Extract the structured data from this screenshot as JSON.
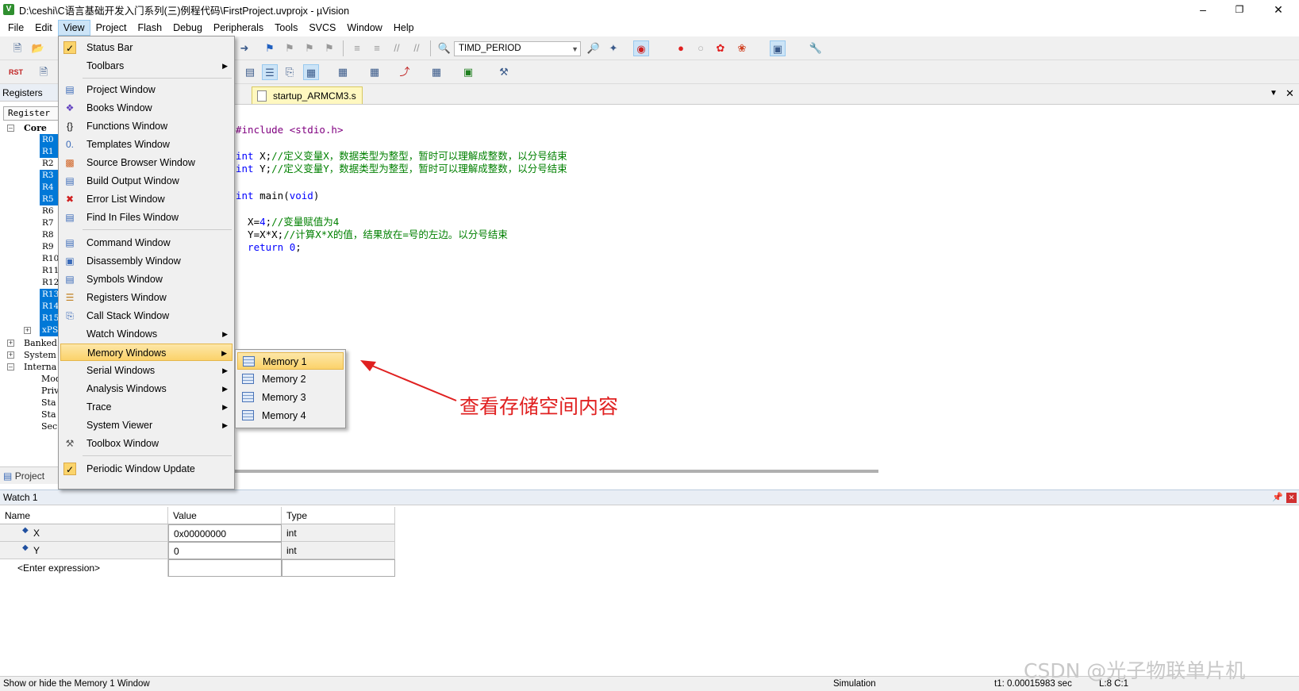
{
  "window": {
    "title": "D:\\ceshi\\C语言基础开发入门系列(三)例程代码\\FirstProject.uvprojx - µVision",
    "icon_letter": "V"
  },
  "menubar": [
    "File",
    "Edit",
    "View",
    "Project",
    "Flash",
    "Debug",
    "Peripherals",
    "Tools",
    "SVCS",
    "Window",
    "Help"
  ],
  "toolbar": {
    "target_combo": "TIMD_PERIOD"
  },
  "registers_panel": {
    "title": "Registers",
    "column": "Register",
    "core_label": "Core",
    "regs": [
      "R0",
      "R1",
      "R2",
      "R3",
      "R4",
      "R5",
      "R6",
      "R7",
      "R8",
      "R9",
      "R10",
      "R11",
      "R12",
      "R13",
      "R14",
      "R15",
      "xPS"
    ],
    "selected": [
      "R0",
      "R1",
      "R3",
      "R4",
      "R5",
      "R13",
      "R14",
      "R15",
      "xPS"
    ],
    "groups": [
      "Banked",
      "System",
      "Interna"
    ],
    "internal_children": [
      "Mode",
      "Priv",
      "Sta",
      "Sta",
      "Sec"
    ],
    "bottom_tab": "Project"
  },
  "editor": {
    "tab_label": "startup_ARMCM3.s",
    "lines": [
      {
        "pre": "#include ",
        "str": "<stdio.h>",
        "cm": ""
      },
      {
        "pre": "",
        "str": "",
        "cm": ""
      },
      {
        "kw": "int",
        " pre": "",
        "code": " X;",
        "cm": "//定义变量X，数据类型为整型，暂时可以理解成整数，以分号结束"
      },
      {
        "kw": "int",
        "code": " Y;",
        "cm": "//定义变量Y，数据类型为整型，暂时可以理解成整数，以分号结束"
      }
    ],
    "code": {
      "l1a": "#include ",
      "l1b": "<stdio.h>",
      "l3kw": "int",
      "l3code": " X;",
      "l3cm": "//定义变量X，数据类型为整型，暂时可以理解成整数，以分号结束",
      "l4kw": "int",
      "l4code": " Y;",
      "l4cm": "//定义变量Y，数据类型为整型，暂时可以理解成整数，以分号结束",
      "l6kw": "int",
      "l6code": " main(",
      "l6kw2": "void",
      "l6end": ")",
      "l8code": "  X=",
      "l8num": "4",
      "l8semi": ";",
      "l8cm": "//变量赋值为4",
      "l9code": "  Y=X*X;",
      "l9cm": "//计算X*X的值，结果放在=号的左边。以分号结束",
      "l10kw": "  return",
      "l10num": " 0",
      "l10semi": ";"
    }
  },
  "view_menu": {
    "items": [
      {
        "label": "Status Bar",
        "checked": true,
        "icon": "check"
      },
      {
        "label": "Toolbars",
        "submenu": true
      },
      {
        "label": "Project Window",
        "icon": "project-window-icon"
      },
      {
        "label": "Books Window",
        "icon": "books-icon"
      },
      {
        "label": "Functions Window",
        "icon": "braces-icon"
      },
      {
        "label": "Templates Window",
        "icon": "templates-icon"
      },
      {
        "label": "Source Browser Window",
        "icon": "source-browser-icon"
      },
      {
        "label": "Build Output Window",
        "icon": "build-output-icon"
      },
      {
        "label": "Error List Window",
        "icon": "error-icon"
      },
      {
        "label": "Find In Files Window",
        "icon": "find-files-icon"
      },
      {
        "label": "Command Window",
        "icon": "command-icon"
      },
      {
        "label": "Disassembly Window",
        "icon": "disassembly-icon"
      },
      {
        "label": "Symbols Window",
        "icon": "symbols-icon"
      },
      {
        "label": "Registers Window",
        "icon": "registers-icon"
      },
      {
        "label": "Call Stack Window",
        "icon": "call-stack-icon"
      },
      {
        "label": "Watch Windows",
        "submenu": true
      },
      {
        "label": "Memory Windows",
        "submenu": true,
        "highlighted": true
      },
      {
        "label": "Serial Windows",
        "submenu": true
      },
      {
        "label": "Analysis Windows",
        "submenu": true
      },
      {
        "label": "Trace",
        "submenu": true
      },
      {
        "label": "System Viewer",
        "submenu": true
      },
      {
        "label": "Toolbox Window",
        "icon": "toolbox-icon"
      },
      {
        "label": "Periodic Window Update",
        "checked": true,
        "icon": "check"
      }
    ]
  },
  "memory_submenu": [
    "Memory 1",
    "Memory 2",
    "Memory 3",
    "Memory 4"
  ],
  "annotation": "查看存储空间内容",
  "watch": {
    "title": "Watch 1",
    "headers": [
      "Name",
      "Value",
      "Type"
    ],
    "rows": [
      {
        "name": "X",
        "value": "0x00000000",
        "type": "int"
      },
      {
        "name": "Y",
        "value": "0",
        "type": "int"
      },
      {
        "name": "<Enter expression>",
        "value": "",
        "type": ""
      }
    ]
  },
  "statusbar": {
    "hint": "Show or hide the Memory 1 Window",
    "mode": "Simulation",
    "time": "t1: 0.00015983 sec",
    "pos": "L:8 C:1"
  },
  "watermark": "CSDN @光子物联单片机"
}
